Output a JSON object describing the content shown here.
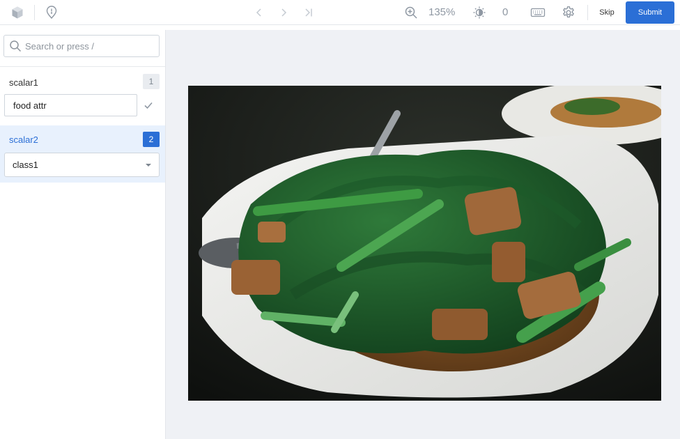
{
  "toolbar": {
    "zoom": "135%",
    "brightness_value": "0",
    "skip_label": "Skip",
    "submit_label": "Submit"
  },
  "sidebar": {
    "search_placeholder": "Search or press /",
    "fields": [
      {
        "label": "scalar1",
        "index": "1",
        "value": "food attr"
      },
      {
        "label": "scalar2",
        "index": "2",
        "value": "class1"
      }
    ]
  },
  "colors": {
    "accent": "#2b6fd6",
    "active_bg": "#e8f1fd",
    "canvas_bg": "#eff1f5"
  },
  "icons": [
    "logo-cube-icon",
    "location-pin-icon",
    "chevron-left-icon",
    "chevron-right-icon",
    "skip-to-end-icon",
    "zoom-in-icon",
    "brightness-icon",
    "keyboard-icon",
    "settings-gear-icon",
    "search-icon",
    "checkmark-icon",
    "chevron-down-icon"
  ]
}
